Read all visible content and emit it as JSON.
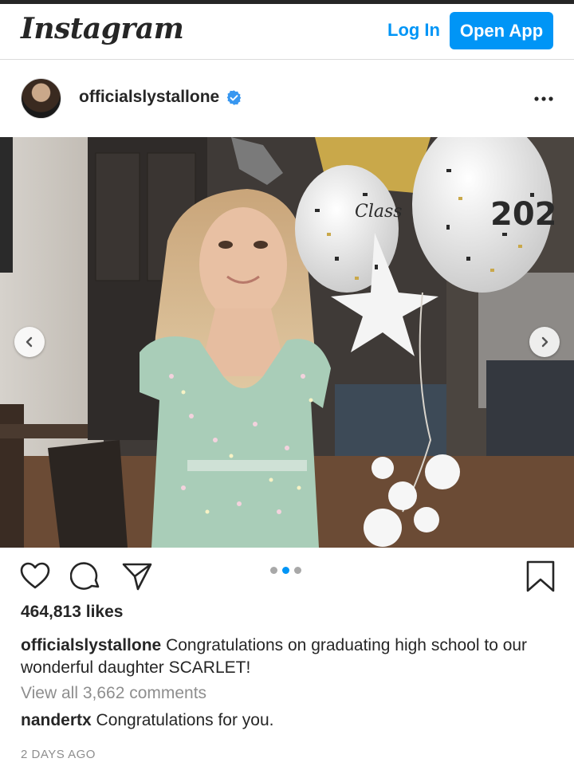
{
  "header": {
    "logo": "Instagram",
    "login_label": "Log In",
    "open_app_label": "Open App"
  },
  "post": {
    "username": "officialslystallone",
    "verified": true,
    "likes": "464,813 likes",
    "caption_user": "officialslystallone",
    "caption_text": "Congratulations on graduating high school to our wonderful daughter SCARLET!",
    "view_all_comments": "View all 3,662 comments",
    "comment": {
      "user": "nandertx",
      "text": "Congratulations for you."
    },
    "time_ago": "2 DAYS AGO",
    "carousel": {
      "count": 3,
      "active_index": 1
    },
    "balloon_text": [
      "Class",
      "202"
    ]
  },
  "colors": {
    "accent": "#0095f6",
    "text": "#262626",
    "muted": "#8e8e8e",
    "border": "#dbdbdb"
  },
  "icons": [
    "more-options-icon",
    "verified-badge-icon",
    "heart-icon",
    "comment-icon",
    "share-icon",
    "bookmark-icon",
    "chevron-left-icon",
    "chevron-right-icon"
  ]
}
